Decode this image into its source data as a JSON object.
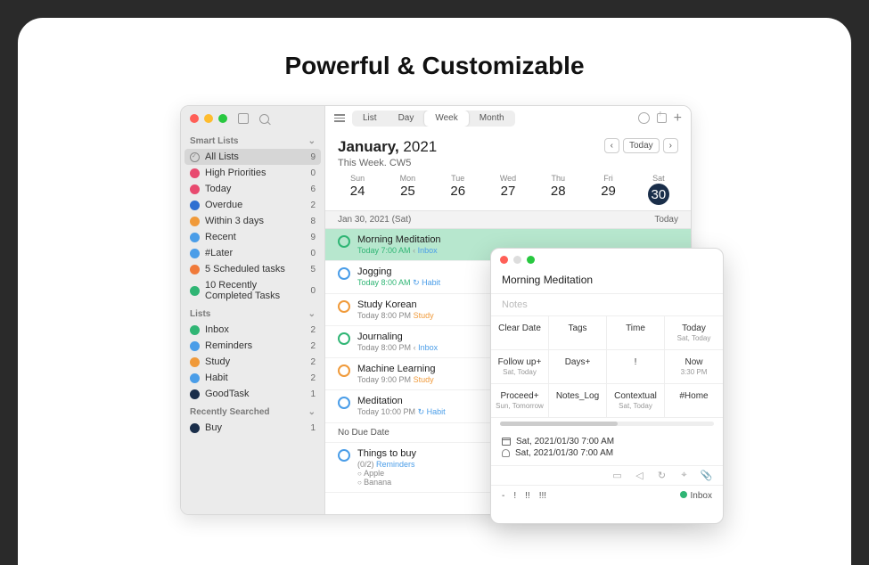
{
  "headline": "Powerful & Customizable",
  "sidebar": {
    "section_smart": "Smart Lists",
    "section_lists": "Lists",
    "section_recent": "Recently Searched",
    "smart": [
      {
        "label": "All Lists",
        "count": "9",
        "color": "check"
      },
      {
        "label": "High Priorities",
        "count": "0",
        "color": "#e84a6f"
      },
      {
        "label": "Today",
        "count": "6",
        "color": "#e84a6f"
      },
      {
        "label": "Overdue",
        "count": "2",
        "color": "#2f6fd1"
      },
      {
        "label": "Within 3 days",
        "count": "8",
        "color": "#f09a3a"
      },
      {
        "label": "Recent",
        "count": "9",
        "color": "#4a9de8"
      },
      {
        "label": "#Later",
        "count": "0",
        "color": "#4a9de8"
      },
      {
        "label": "5 Scheduled tasks",
        "count": "5",
        "color": "#f07a3a"
      },
      {
        "label": "10 Recently Completed Tasks",
        "count": "0",
        "color": "#2fb574"
      }
    ],
    "lists": [
      {
        "label": "Inbox",
        "count": "2",
        "color": "#2fb574"
      },
      {
        "label": "Reminders",
        "count": "2",
        "color": "#4a9de8"
      },
      {
        "label": "Study",
        "count": "2",
        "color": "#f09a3a"
      },
      {
        "label": "Habit",
        "count": "2",
        "color": "#4a9de8"
      },
      {
        "label": "GoodTask",
        "count": "1",
        "color": "#1a2e4a"
      }
    ],
    "recent": [
      {
        "label": "Buy",
        "count": "1",
        "color": "#1a2e4a"
      }
    ]
  },
  "toolbar": {
    "views": [
      "List",
      "Day",
      "Week",
      "Month"
    ],
    "active": 2
  },
  "calendar": {
    "month": "January,",
    "year": "2021",
    "subtitle": "This Week. CW5",
    "today_btn": "Today",
    "days": [
      {
        "name": "Sun",
        "num": "24"
      },
      {
        "name": "Mon",
        "num": "25"
      },
      {
        "name": "Tue",
        "num": "26"
      },
      {
        "name": "Wed",
        "num": "27"
      },
      {
        "name": "Thu",
        "num": "28"
      },
      {
        "name": "Fri",
        "num": "29"
      },
      {
        "name": "Sat",
        "num": "30",
        "current": true
      }
    ],
    "datebar_left": "Jan 30, 2021 (Sat)",
    "datebar_right": "Today"
  },
  "tasks": [
    {
      "title": "Morning Meditation",
      "meta_today": "Today 7:00 AM",
      "list": "Inbox",
      "list_cls": "list-link",
      "circle": "tc-green",
      "hl": true,
      "repeat": false,
      "chev": true
    },
    {
      "title": "Jogging",
      "meta_today": "Today 8:00 AM",
      "list": "Habit",
      "list_cls": "list-link",
      "circle": "tc-blue",
      "repeat": true
    },
    {
      "title": "Study Korean",
      "meta": "Today 8:00 PM",
      "list": "Study",
      "list_cls": "list-tag",
      "circle": "tc-orange"
    },
    {
      "title": "Journaling",
      "meta": "Today 8:00 PM",
      "list": "Inbox",
      "list_cls": "list-link",
      "circle": "tc-green",
      "chev": true
    },
    {
      "title": "Machine Learning",
      "meta": "Today 9:00 PM",
      "list": "Study",
      "list_cls": "list-tag",
      "circle": "tc-orange"
    },
    {
      "title": "Meditation",
      "meta": "Today 10:00 PM",
      "list": "Habit",
      "list_cls": "list-link",
      "circle": "tc-blue",
      "repeat": true
    }
  ],
  "nodue_header": "No Due Date",
  "nodue": {
    "title": "Things to buy",
    "meta": "(0/2)",
    "list": "Reminders",
    "circle": "tc-blue",
    "subs": [
      "Apple",
      "Banana"
    ]
  },
  "popup": {
    "title": "Morning Meditation",
    "notes_ph": "Notes",
    "grid": [
      {
        "m": "Clear Date"
      },
      {
        "m": "Tags"
      },
      {
        "m": "Time"
      },
      {
        "m": "Today",
        "s": "Sat, Today"
      },
      {
        "m": "Follow up+",
        "s": "Sat, Today"
      },
      {
        "m": "Days+"
      },
      {
        "m": "!"
      },
      {
        "m": "Now",
        "s": "3:30 PM"
      },
      {
        "m": "Proceed+",
        "s": "Sun, Tomorrow"
      },
      {
        "m": "Notes_Log"
      },
      {
        "m": "Contextual",
        "s": "Sat, Today"
      },
      {
        "m": "#Home"
      }
    ],
    "date1": "Sat, 2021/01/30 7:00 AM",
    "date2": "Sat, 2021/01/30 7:00 AM",
    "priority": [
      "!",
      "!!",
      "!!!"
    ],
    "dash": "-",
    "inbox": "Inbox"
  }
}
